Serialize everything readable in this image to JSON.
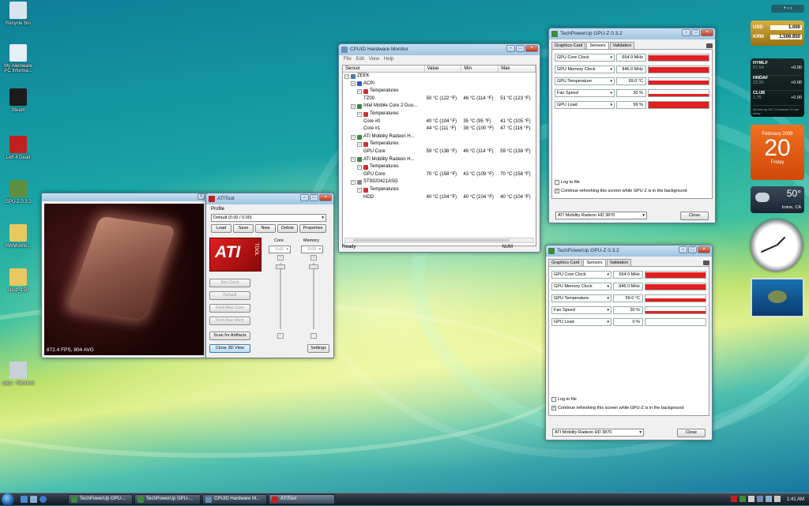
{
  "desktop_icons": [
    {
      "label": "Recycle Bin",
      "icon": "recycle-bin-icon",
      "color": "#d9e4ee"
    },
    {
      "label": "My Alienware PC Informa...",
      "icon": "document-icon",
      "color": "#e6eef6"
    },
    {
      "label": "Steam",
      "icon": "steam-icon",
      "color": "#1b1b1b"
    },
    {
      "label": "Left 4 Dead",
      "icon": "left4dead-icon",
      "color": "#c02020"
    },
    {
      "label": "GPU-Z.0.3.2",
      "icon": "gpuz-icon",
      "color": "#5f8f40"
    },
    {
      "label": "HWMonito...",
      "icon": "folder-icon",
      "color": "#e8c860"
    },
    {
      "label": "cpuz_150",
      "icon": "folder-icon",
      "color": "#e8c860"
    },
    {
      "label": "cpuz - Shortcut",
      "icon": "cpuz-icon",
      "color": "#c8d0d8"
    }
  ],
  "render_window": {
    "fps": "872.4 FPS, 804 AVG"
  },
  "atitool": {
    "title": "ATITool",
    "profile_label": "Profile",
    "profile_value": "Default (0.00 / 0.00)",
    "buttons": [
      "Load",
      "Save",
      "New",
      "Delete",
      "Properties"
    ],
    "logo_text": "ATI",
    "logo_sub": "TOOL",
    "core_label": "Core",
    "memory_label": "Memory",
    "core_value": "0.00",
    "memory_value": "0.00",
    "side_buttons": [
      "Set Clock",
      "Default",
      "Find Max Core",
      "Find Max Mem"
    ],
    "scan_label": "Scan for Artifacts",
    "close3d_label": "Close 3D View",
    "settings_label": "Settings"
  },
  "hwmon": {
    "title": "CPUID Hardware Monitor",
    "menu": [
      "File",
      "Edit",
      "View",
      "Help"
    ],
    "columns": [
      "Sensor",
      "Value",
      "Min",
      "Max"
    ],
    "rows": [
      {
        "d": 0,
        "n": "ZEEK",
        "v": "",
        "mi": "",
        "ma": "",
        "ic": "#4a7ab0"
      },
      {
        "d": 1,
        "n": "ACPI",
        "v": "",
        "mi": "",
        "ma": "",
        "ic": "#2a5ad0"
      },
      {
        "d": 2,
        "n": "Temperatures",
        "v": "",
        "mi": "",
        "ma": "",
        "ic": "#d03030"
      },
      {
        "d": 3,
        "n": "TZ00",
        "v": "50 °C  (122 °F)",
        "mi": "46 °C  (114 °F)",
        "ma": "51 °C  (123 °F)",
        "ic": ""
      },
      {
        "d": 1,
        "n": "Intel Mobile Core 2 Duo...",
        "v": "",
        "mi": "",
        "ma": "",
        "ic": "#3a8a3a"
      },
      {
        "d": 2,
        "n": "Temperatures",
        "v": "",
        "mi": "",
        "ma": "",
        "ic": "#d03030"
      },
      {
        "d": 3,
        "n": "Core #0",
        "v": "40 °C  (104 °F)",
        "mi": "35 °C  (95 °F)",
        "ma": "41 °C  (105 °F)",
        "ic": ""
      },
      {
        "d": 3,
        "n": "Core #1",
        "v": "44 °C  (111 °F)",
        "mi": "38 °C  (100 °F)",
        "ma": "47 °C  (116 °F)",
        "ic": ""
      },
      {
        "d": 1,
        "n": "ATI Mobility Radeon H...",
        "v": "",
        "mi": "",
        "ma": "",
        "ic": "#3a8a3a"
      },
      {
        "d": 2,
        "n": "Temperatures",
        "v": "",
        "mi": "",
        "ma": "",
        "ic": "#d03030"
      },
      {
        "d": 3,
        "n": "GPU Core",
        "v": "59 °C  (138 °F)",
        "mi": "46 °C  (114 °F)",
        "ma": "59 °C  (138 °F)",
        "ic": ""
      },
      {
        "d": 1,
        "n": "ATI Mobility Radeon H...",
        "v": "",
        "mi": "",
        "ma": "",
        "ic": "#3a8a3a"
      },
      {
        "d": 2,
        "n": "Temperatures",
        "v": "",
        "mi": "",
        "ma": "",
        "ic": "#d03030"
      },
      {
        "d": 3,
        "n": "GPU Core",
        "v": "70 °C  (158 °F)",
        "mi": "43 °C  (109 °F)",
        "ma": "70 °C  (158 °F)",
        "ic": ""
      },
      {
        "d": 1,
        "n": "ST9320421ASG",
        "v": "",
        "mi": "",
        "ma": "",
        "ic": "#888888"
      },
      {
        "d": 2,
        "n": "Temperatures",
        "v": "",
        "mi": "",
        "ma": "",
        "ic": "#d03030"
      },
      {
        "d": 3,
        "n": "HDD",
        "v": "40 °C  (104 °F)",
        "mi": "40 °C  (104 °F)",
        "ma": "40 °C  (104 °F)",
        "ic": ""
      }
    ],
    "status": "Ready",
    "num": "NUM"
  },
  "gpuz1": {
    "title": "TechPowerUp GPU-Z 0.3.2",
    "tabs": [
      "Graphics Card",
      "Sensors",
      "Validation"
    ],
    "sensors": [
      {
        "name": "GPU Core Clock",
        "value": "654.0 MHz",
        "fill": 0.8
      },
      {
        "name": "GPU Memory Clock",
        "value": "846.0 MHz",
        "fill": 0.8
      },
      {
        "name": "GPU Temperature",
        "value": "69.0 °C",
        "fill": 0.6
      },
      {
        "name": "Fan Speed",
        "value": "30 %",
        "fill": 0.3
      },
      {
        "name": "GPU Load",
        "value": "99 %",
        "fill": 0.95
      }
    ],
    "log_label": "Log to file",
    "continue_label": "Continue refreshing this screen while GPU-Z is in the background",
    "card": "ATI Mobility Radeon HD 3870",
    "close_label": "Close"
  },
  "gpuz2": {
    "title": "TechPowerUp GPU-Z 0.3.2",
    "tabs": [
      "Graphics Card",
      "Sensors",
      "Validation"
    ],
    "sensors": [
      {
        "name": "GPU Core Clock",
        "value": "654.0 MHz",
        "fill": 0.8
      },
      {
        "name": "GPU Memory Clock",
        "value": "846.0 MHz",
        "fill": 0.8
      },
      {
        "name": "GPU Temperature",
        "value": "59.0 °C",
        "fill": 0.5
      },
      {
        "name": "Fan Speed",
        "value": "30 %",
        "fill": 0.3
      },
      {
        "name": "GPU Load",
        "value": "0 %",
        "fill": 0
      }
    ],
    "log_label": "Log to file",
    "continue_label": "Continue refreshing this screen while GPU-Z is in the background",
    "card": "ATI Mobility Radeon HD 3870",
    "close_label": "Close"
  },
  "gadgets": {
    "currency": {
      "from": "USD",
      "from_val": "1.000",
      "to": "KRW",
      "to_val": "1,506.850"
    },
    "stocks": [
      {
        "sym": "HYMLF",
        "price": "57.64",
        "chg": "+0.00"
      },
      {
        "sym": "HNDAF",
        "price": "23.95",
        "chg": "+0.00"
      },
      {
        "sym": "CLUB",
        "price": "1.75",
        "chg": "+0.00"
      }
    ],
    "stocks_note": "Quotes by IDC Comstock 20 min delay",
    "calendar": {
      "month": "February 2009",
      "day": "20",
      "weekday": "Friday"
    },
    "weather": {
      "temp": "50°",
      "city": "Irvine, CA"
    }
  },
  "taskbar": {
    "tasks": [
      {
        "label": "TechPowerUp GPU-...",
        "color": "#3d8a3d"
      },
      {
        "label": "TechPowerUp GPU-...",
        "color": "#3d8a3d"
      },
      {
        "label": "CPUID Hardware M...",
        "color": "#6a8ab0"
      },
      {
        "label": "ATITool",
        "color": "#c02020"
      }
    ],
    "clock": "1:41 AM"
  },
  "colors": {
    "accent_red": "#e02020",
    "title_blue": "#a8cae6"
  }
}
